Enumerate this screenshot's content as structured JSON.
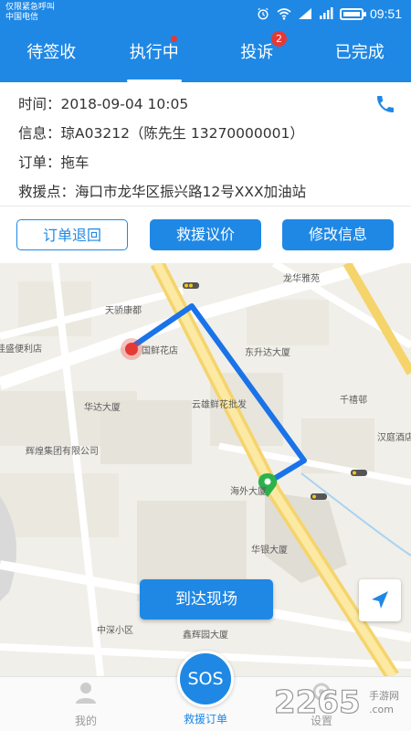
{
  "status_bar": {
    "carrier_line1": "仅限紧急呼叫",
    "carrier_line2": "中国电信",
    "time": "09:51",
    "icons": [
      "alarm-icon",
      "wifi-icon",
      "signal-icon",
      "battery-icon"
    ]
  },
  "tabs": [
    {
      "label": "待签收",
      "active": false
    },
    {
      "label": "执行中",
      "active": true,
      "dot": true
    },
    {
      "label": "投诉",
      "active": false,
      "badge": "2"
    },
    {
      "label": "已完成",
      "active": false
    }
  ],
  "order": {
    "time_label": "时间：",
    "time_value": "2018-09-04  10:05",
    "info_label": "信息：",
    "info_value": "琼A03212（陈先生  13270000001）",
    "type_label": "订单：",
    "type_value": "拖车",
    "location_label": "救援点：",
    "location_value": "海口市龙华区振兴路12号XXX加油站"
  },
  "actions": {
    "return_label": "订单退回",
    "price_label": "救援议价",
    "edit_label": "修改信息"
  },
  "map": {
    "pois": [
      "天骄康都",
      "佳盛便利店",
      "国鲜花店",
      "龙华雅苑",
      "东升达大厦",
      "华达大厦",
      "云雄鲜花批发",
      "千禧邨",
      "汉庭酒店",
      "辉煌集团有限公司",
      "海外大厦",
      "华银大厦",
      "中深小区",
      "鑫辉园大厦"
    ],
    "arrive_label": "到达现场"
  },
  "bottom_nav": {
    "mine_label": "我的",
    "sos_label": "SOS",
    "rescue_label": "救援订单",
    "settings_label": "设置"
  },
  "watermark": {
    "brand": "2265",
    "suffix_line1": "手游网",
    "suffix_line2": ".com"
  },
  "colors": {
    "primary": "#1f88e5",
    "badge": "#e53935",
    "route": "#1a73e8",
    "start_marker": "#e53935",
    "end_marker": "#2bb24c"
  }
}
